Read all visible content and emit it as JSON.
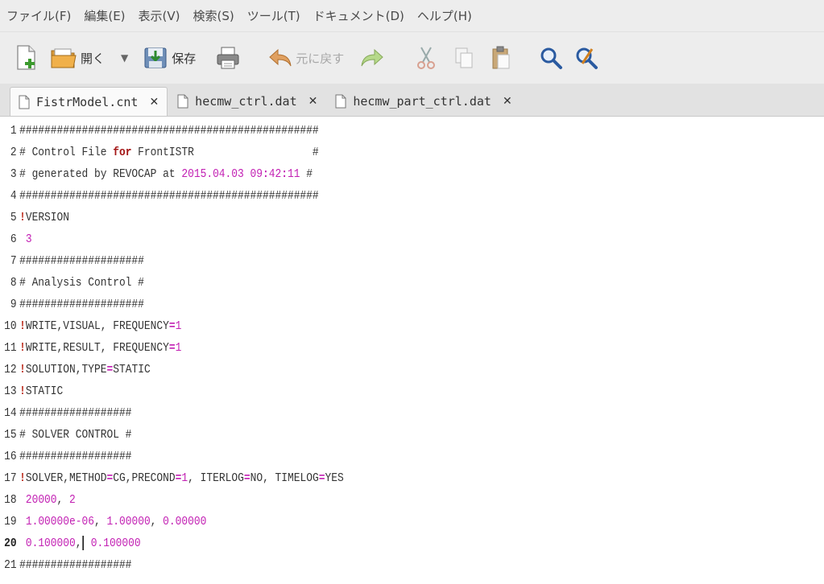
{
  "menubar": {
    "items": [
      "ファイル(F)",
      "編集(E)",
      "表示(V)",
      "検索(S)",
      "ツール(T)",
      "ドキュメント(D)",
      "ヘルプ(H)"
    ]
  },
  "toolbar": {
    "open_label": "開く",
    "save_label": "保存",
    "undo_label": "元に戻す"
  },
  "tabs": [
    {
      "label": "FistrModel.cnt",
      "active": true
    },
    {
      "label": "hecmw_ctrl.dat",
      "active": false
    },
    {
      "label": "hecmw_part_ctrl.dat",
      "active": false
    }
  ],
  "editor": {
    "current_line": 20,
    "lines": [
      {
        "n": "1",
        "t": "################################################"
      },
      {
        "n": "2",
        "t": "# Control File for FrontISTR                   #"
      },
      {
        "n": "3",
        "t": "# generated by REVOCAP at 2015.04.03 09:42:11 #"
      },
      {
        "n": "4",
        "t": "################################################"
      },
      {
        "n": "5",
        "t": "!VERSION"
      },
      {
        "n": "6",
        "t": " 3"
      },
      {
        "n": "7",
        "t": "####################"
      },
      {
        "n": "8",
        "t": "# Analysis Control #"
      },
      {
        "n": "9",
        "t": "####################"
      },
      {
        "n": "10",
        "t": "!WRITE,VISUAL, FREQUENCY=1"
      },
      {
        "n": "11",
        "t": "!WRITE,RESULT, FREQUENCY=1"
      },
      {
        "n": "12",
        "t": "!SOLUTION,TYPE=STATIC"
      },
      {
        "n": "13",
        "t": "!STATIC"
      },
      {
        "n": "14",
        "t": "##################"
      },
      {
        "n": "15",
        "t": "# SOLVER CONTROL #"
      },
      {
        "n": "16",
        "t": "##################"
      },
      {
        "n": "17",
        "t": "!SOLVER,METHOD=CG,PRECOND=1, ITERLOG=NO, TIMELOG=YES"
      },
      {
        "n": "18",
        "t": " 20000, 2"
      },
      {
        "n": "19",
        "t": " 1.00000e-06, 1.00000, 0.00000"
      },
      {
        "n": "20",
        "t": " 0.100000, 0.100000"
      },
      {
        "n": "21",
        "t": "##################"
      }
    ]
  },
  "colors": {
    "keyword": "#a31515",
    "number": "#c21fb3",
    "directive": "#c0392b"
  }
}
